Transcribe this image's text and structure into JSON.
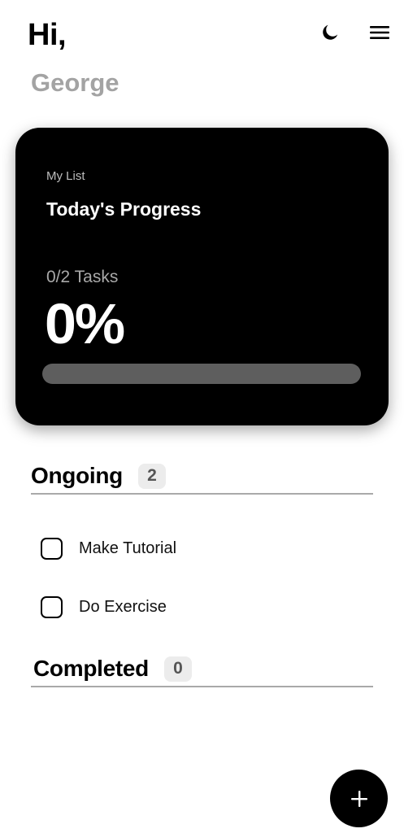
{
  "header": {
    "greeting": "Hi,",
    "user_name": "George",
    "theme_toggle_icon": "moon-icon",
    "menu_icon": "hamburger-menu-icon"
  },
  "progress_card": {
    "subtitle": "My List",
    "title": "Today's Progress",
    "task_count": "0/2 Tasks",
    "percent_label": "0%",
    "progress_fraction": 0
  },
  "ongoing": {
    "title": "Ongoing",
    "count": "2",
    "tasks": [
      {
        "label": "Make Tutorial",
        "checked": false
      },
      {
        "label": "Do Exercise",
        "checked": false
      }
    ]
  },
  "completed": {
    "title": "Completed",
    "count": "0"
  },
  "fab": {
    "icon": "plus-icon"
  },
  "colors": {
    "background": "#ffffff",
    "card": "#000000",
    "muted_text": "#a3a3a3",
    "progress_track": "#5e5e5e",
    "badge_bg": "#ececec"
  }
}
